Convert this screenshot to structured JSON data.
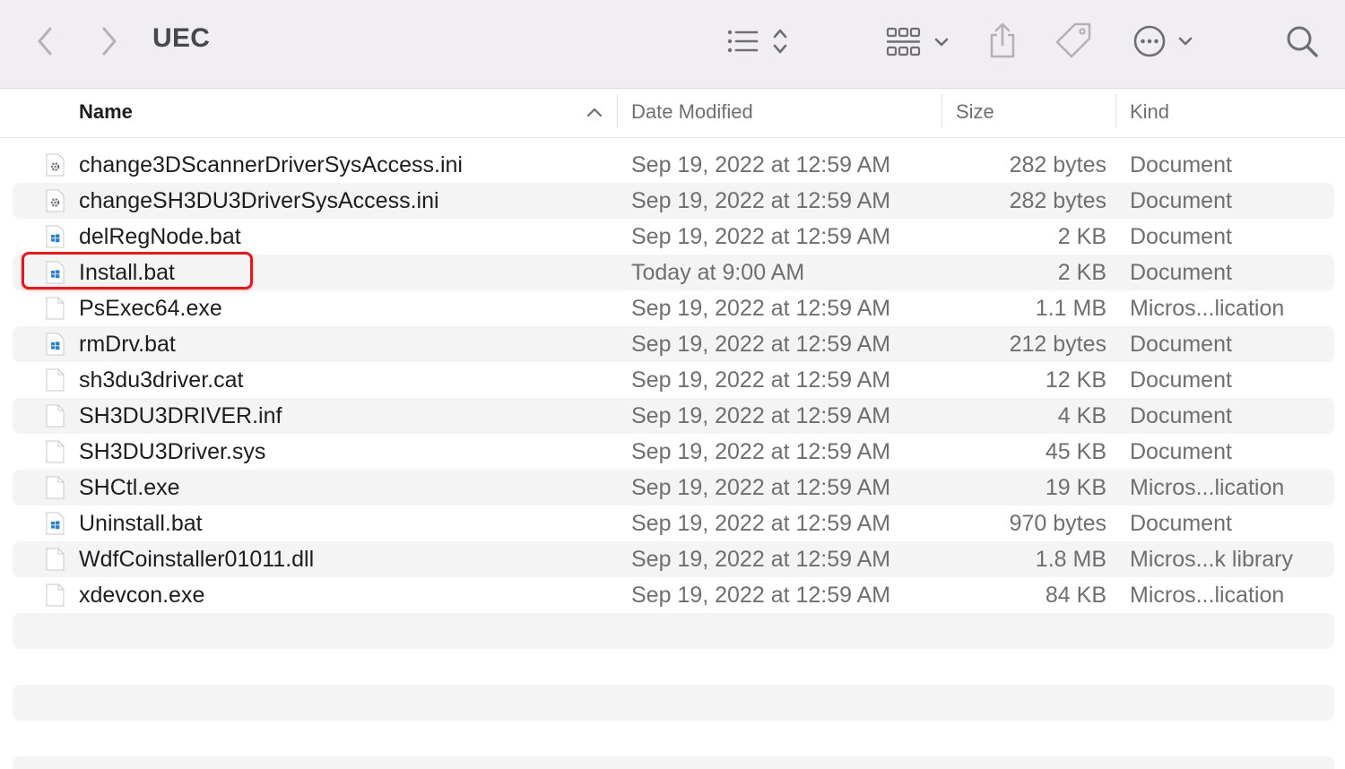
{
  "window": {
    "title": "UEC"
  },
  "toolbar": {
    "back_icon": "chevron-left-icon",
    "forward_icon": "chevron-right-icon",
    "list_view_icon": "list-icon",
    "group_icon": "grid-icon",
    "share_icon": "share-icon",
    "tag_icon": "tag-icon",
    "more_icon": "ellipsis-circle-icon",
    "search_icon": "search-icon"
  },
  "columns": {
    "name": "Name",
    "date": "Date Modified",
    "size": "Size",
    "kind": "Kind"
  },
  "highlight_color": "#e0191f",
  "files": [
    {
      "name": "change3DScannerDriverSysAccess.ini",
      "date": "Sep 19, 2022 at 12:59 AM",
      "size": "282 bytes",
      "kind": "Document",
      "icon": "gear-doc-icon"
    },
    {
      "name": "changeSH3DU3DriverSysAccess.ini",
      "date": "Sep 19, 2022 at 12:59 AM",
      "size": "282 bytes",
      "kind": "Document",
      "icon": "gear-doc-icon"
    },
    {
      "name": "delRegNode.bat",
      "date": "Sep 19, 2022 at 12:59 AM",
      "size": "2 KB",
      "kind": "Document",
      "icon": "windows-doc-icon"
    },
    {
      "name": "Install.bat",
      "date": "Today at 9:00 AM",
      "size": "2 KB",
      "kind": "Document",
      "icon": "windows-doc-icon"
    },
    {
      "name": "PsExec64.exe",
      "date": "Sep 19, 2022 at 12:59 AM",
      "size": "1.1 MB",
      "kind": "Micros...lication",
      "icon": "blank-doc-icon"
    },
    {
      "name": "rmDrv.bat",
      "date": "Sep 19, 2022 at 12:59 AM",
      "size": "212 bytes",
      "kind": "Document",
      "icon": "windows-doc-icon"
    },
    {
      "name": "sh3du3driver.cat",
      "date": "Sep 19, 2022 at 12:59 AM",
      "size": "12 KB",
      "kind": "Document",
      "icon": "blank-doc-icon"
    },
    {
      "name": "SH3DU3DRIVER.inf",
      "date": "Sep 19, 2022 at 12:59 AM",
      "size": "4 KB",
      "kind": "Document",
      "icon": "blank-doc-icon"
    },
    {
      "name": "SH3DU3Driver.sys",
      "date": "Sep 19, 2022 at 12:59 AM",
      "size": "45 KB",
      "kind": "Document",
      "icon": "blank-doc-icon"
    },
    {
      "name": "SHCtl.exe",
      "date": "Sep 19, 2022 at 12:59 AM",
      "size": "19 KB",
      "kind": "Micros...lication",
      "icon": "blank-doc-icon"
    },
    {
      "name": "Uninstall.bat",
      "date": "Sep 19, 2022 at 12:59 AM",
      "size": "970 bytes",
      "kind": "Document",
      "icon": "windows-doc-icon"
    },
    {
      "name": "WdfCoinstaller01011.dll",
      "date": "Sep 19, 2022 at 12:59 AM",
      "size": "1.8 MB",
      "kind": "Micros...k library",
      "icon": "blank-doc-icon"
    },
    {
      "name": "xdevcon.exe",
      "date": "Sep 19, 2022 at 12:59 AM",
      "size": "84 KB",
      "kind": "Micros...lication",
      "icon": "blank-doc-icon"
    }
  ]
}
